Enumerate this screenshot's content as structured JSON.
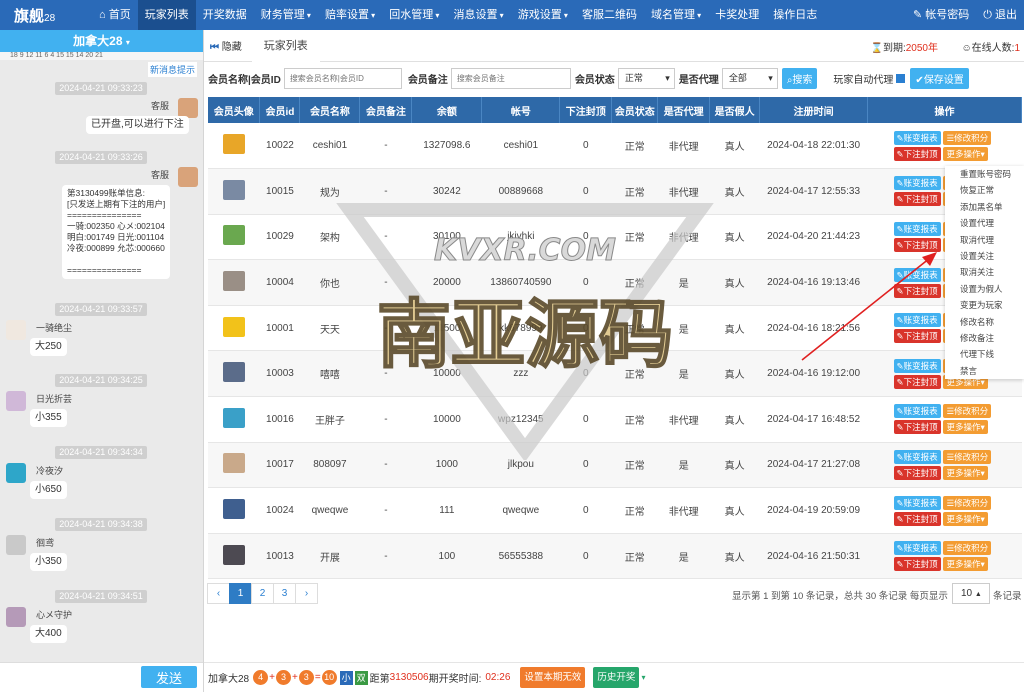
{
  "nav": {
    "brand": "旗舰",
    "brand_sub": "28",
    "items": [
      {
        "label": "首页",
        "icon": "home-icon",
        "caret": false,
        "active": false
      },
      {
        "label": "玩家列表",
        "caret": false,
        "active": true
      },
      {
        "label": "开奖数据",
        "caret": false,
        "active": false
      },
      {
        "label": "财务管理",
        "caret": true,
        "active": false
      },
      {
        "label": "赔率设置",
        "caret": true,
        "active": false
      },
      {
        "label": "回水管理",
        "caret": true,
        "active": false
      },
      {
        "label": "消息设置",
        "caret": true,
        "active": false
      },
      {
        "label": "游戏设置",
        "caret": true,
        "active": false
      },
      {
        "label": "客服二维码",
        "caret": false,
        "active": false
      },
      {
        "label": "域名管理",
        "caret": true,
        "active": false
      },
      {
        "label": "卡奖处理",
        "caret": false,
        "active": false
      },
      {
        "label": "操作日志",
        "caret": false,
        "active": false
      }
    ],
    "account_password": "帐号密码",
    "logout": "退出"
  },
  "chat": {
    "header": "加拿大28",
    "header_sub": "18 9 12 11 6 4 15 15 14 20 21",
    "new_tip": "新消息提示",
    "send_label": "发送",
    "messages": [
      {
        "time": "2024-04-21 09:33:23",
        "name": "客服",
        "text": "已开盘,可以进行下注",
        "side": "right"
      },
      {
        "time": "2024-04-21 09:33:26",
        "name": "客服",
        "text": "第3130499账单信息:\n[只发送上期有下注的用户]\n===============\n一骑:002350 心メ:002104\n明白:001749 日光:001104\n冷夜:000899 允芯:000660\n\n===============",
        "side": "right"
      },
      {
        "time": "2024-04-21 09:33:57",
        "name": "一骑绝尘",
        "text": "大250",
        "side": "left"
      },
      {
        "time": "2024-04-21 09:34:25",
        "name": "日光折芸",
        "text": "小355",
        "side": "left"
      },
      {
        "time": "2024-04-21 09:34:34",
        "name": "冷夜汐",
        "text": "小650",
        "side": "left"
      },
      {
        "time": "2024-04-21 09:34:38",
        "name": "徊鸢",
        "text": "小350",
        "side": "left"
      },
      {
        "time": "2024-04-21 09:34:51",
        "name": "心メ守护",
        "text": "大400",
        "side": "left"
      }
    ]
  },
  "main": {
    "hide_label": "隐藏",
    "tab_label": "玩家列表",
    "expire_label": "到期:",
    "expire_value": "2050年",
    "online_label": "在线人数:",
    "online_value": "1"
  },
  "filters": {
    "member_label": "会员名称|会员ID",
    "member_placeholder": "搜索会员名称|会员ID",
    "remark_label": "会员备注",
    "remark_placeholder": "搜索会员备注",
    "status_label": "会员状态",
    "status_value": "正常",
    "agent_label": "是否代理",
    "agent_value": "全部",
    "search_label": "搜索",
    "auto_agent_label": "玩家自动代理",
    "save_label": "保存设置"
  },
  "table": {
    "headers": [
      "会员头像",
      "会员id",
      "会员名称",
      "会员备注",
      "余额",
      "帐号",
      "下注封顶",
      "会员状态",
      "是否代理",
      "是否假人",
      "注册时间",
      "操作"
    ],
    "rows": [
      {
        "id": "10022",
        "name": "ceshi01",
        "remark": "-",
        "balance": "1327098.6",
        "account": "ceshi01",
        "cap": "0",
        "status": "正常",
        "agent": "非代理",
        "fake": "真人",
        "reg": "2024-04-18 22:01:30",
        "avatar": "#e8a628"
      },
      {
        "id": "10015",
        "name": "规为",
        "remark": "-",
        "balance": "30242",
        "account": "00889668",
        "cap": "0",
        "status": "正常",
        "agent": "非代理",
        "fake": "真人",
        "reg": "2024-04-17 12:55:33",
        "avatar": "#7a8aa3"
      },
      {
        "id": "10029",
        "name": "架构",
        "remark": "-",
        "balance": "30100",
        "account": "jkivhki",
        "cap": "0",
        "status": "正常",
        "agent": "非代理",
        "fake": "真人",
        "reg": "2024-04-20 21:44:23",
        "avatar": "#6aa84f"
      },
      {
        "id": "10004",
        "name": "你也",
        "remark": "-",
        "balance": "20000",
        "account": "13860740590",
        "cap": "0",
        "status": "正常",
        "agent": "是",
        "fake": "真人",
        "reg": "2024-04-16 19:13:46",
        "avatar": "#9a8f86"
      },
      {
        "id": "10001",
        "name": "天天",
        "remark": "-",
        "balance": "11500",
        "account": "kk678999",
        "cap": "0",
        "status": "正常",
        "agent": "是",
        "fake": "真人",
        "reg": "2024-04-16 18:21:56",
        "avatar": "#f2c21a"
      },
      {
        "id": "10003",
        "name": "嘻嘻",
        "remark": "-",
        "balance": "10000",
        "account": "zzz",
        "cap": "0",
        "status": "正常",
        "agent": "是",
        "fake": "真人",
        "reg": "2024-04-16 19:12:00",
        "avatar": "#5b6c8a"
      },
      {
        "id": "10016",
        "name": "王胖子",
        "remark": "-",
        "balance": "10000",
        "account": "wpz12345",
        "cap": "0",
        "status": "正常",
        "agent": "非代理",
        "fake": "真人",
        "reg": "2024-04-17 16:48:52",
        "avatar": "#3aa0c8"
      },
      {
        "id": "10017",
        "name": "808097",
        "remark": "-",
        "balance": "1000",
        "account": "jlkpou",
        "cap": "0",
        "status": "正常",
        "agent": "是",
        "fake": "真人",
        "reg": "2024-04-17 21:27:08",
        "avatar": "#c9a98a"
      },
      {
        "id": "10024",
        "name": "qweqwe",
        "remark": "-",
        "balance": "111",
        "account": "qweqwe",
        "cap": "0",
        "status": "正常",
        "agent": "非代理",
        "fake": "真人",
        "reg": "2024-04-19 20:59:09",
        "avatar": "#3f5f8f"
      },
      {
        "id": "10013",
        "name": "开展",
        "remark": "-",
        "balance": "100",
        "account": "56555388",
        "cap": "0",
        "status": "正常",
        "agent": "是",
        "fake": "真人",
        "reg": "2024-04-16 21:50:31",
        "avatar": "#4d4a52"
      }
    ],
    "ops": {
      "report": "账变报表",
      "edit_points": "修改积分",
      "cap": "下注封顶",
      "more": "更多操作"
    }
  },
  "dropmenu": [
    "重置账号密码",
    "恢复正常",
    "添加黑名单",
    "设置代理",
    "取消代理",
    "设置关注",
    "取消关注",
    "设置为假人",
    "变更为玩家",
    "修改名称",
    "修改备注",
    "代理下线",
    "禁言"
  ],
  "pager": {
    "prev": "‹",
    "pages": [
      "1",
      "2",
      "3"
    ],
    "next": "›",
    "info": "显示第 1 到第 10 条记录，总共 30 条记录  每页显示",
    "size": "10",
    "suffix": "条记录"
  },
  "bottom": {
    "game": "加拿大28",
    "n1": "4",
    "n2": "3",
    "n3": "3",
    "sum": "10",
    "t1": "小",
    "t2": "双",
    "dist_label": "距第",
    "period": "3130506",
    "period_suffix": "期开奖时间:",
    "countdown": "02:26",
    "btn_invalid": "设置本期无效",
    "btn_history": "历史开奖"
  },
  "watermark": {
    "top": "KVXR.COM",
    "main": "南亚源码"
  }
}
